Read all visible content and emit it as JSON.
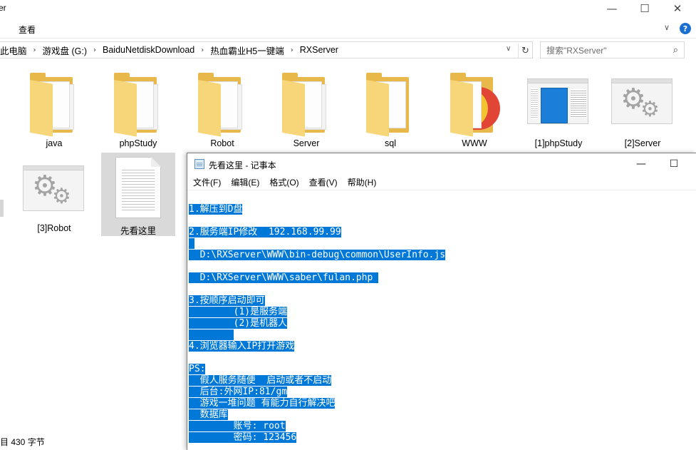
{
  "explorer": {
    "title": "er",
    "window_controls": {
      "minimize": "—",
      "maximize": "☐",
      "close": "✕"
    },
    "ribbon": {
      "tab_view": "查看",
      "expand": "∨",
      "help": "?"
    },
    "address": {
      "crumbs": [
        "此电脑",
        "游戏盘 (G:)",
        "BaiduNetdiskDownload",
        "热血霸业H5一键端",
        "RXServer"
      ],
      "separator": "›",
      "dropdown": "∨",
      "refresh": "↻"
    },
    "search": {
      "placeholder": "搜索\"RXServer\"",
      "icon": "⌕"
    },
    "items": [
      {
        "label": "java",
        "icon": "folder-icon"
      },
      {
        "label": "phpStudy",
        "icon": "folder-icon"
      },
      {
        "label": "Robot",
        "icon": "folder-icon"
      },
      {
        "label": "Server",
        "icon": "folder-icon"
      },
      {
        "label": "sql",
        "icon": "folder-icon"
      },
      {
        "label": "WWW",
        "icon": "folder-icon"
      },
      {
        "label": "[1]phpStudy",
        "icon": "application-icon"
      },
      {
        "label": "[2]Server",
        "icon": "config-icon"
      },
      {
        "label": "[3]Robot",
        "icon": "config-icon"
      },
      {
        "label": "先看这里",
        "icon": "text-document-icon"
      }
    ],
    "status": "目 430 字节"
  },
  "notepad": {
    "title": "先看这里 - 记事本",
    "window_controls": {
      "minimize": "—",
      "maximize": "☐"
    },
    "menu": [
      "文件(F)",
      "编辑(E)",
      "格式(O)",
      "查看(V)",
      "帮助(H)"
    ],
    "lines": [
      "",
      "1.解压到D盘",
      "",
      "2.服务端IP修改  192.168.99.99",
      " ",
      "  D:\\RXServer\\WWW\\bin-debug\\common\\UserInfo.js",
      "",
      "  D:\\RXServer\\WWW\\saber\\fulan.php ",
      "",
      "3.按顺序启动即可",
      "        (1)是服务端",
      "        (2)是机器人",
      "        ",
      "4.浏览器输入IP打开游戏",
      "",
      "PS:",
      "  假人服务随便  启动或者不启动",
      "  后台:外网IP:81/gm",
      "  游戏一堆问题 有能力自行解决吧",
      "  数据库",
      "        账号: root",
      "        密码: 123456"
    ]
  }
}
